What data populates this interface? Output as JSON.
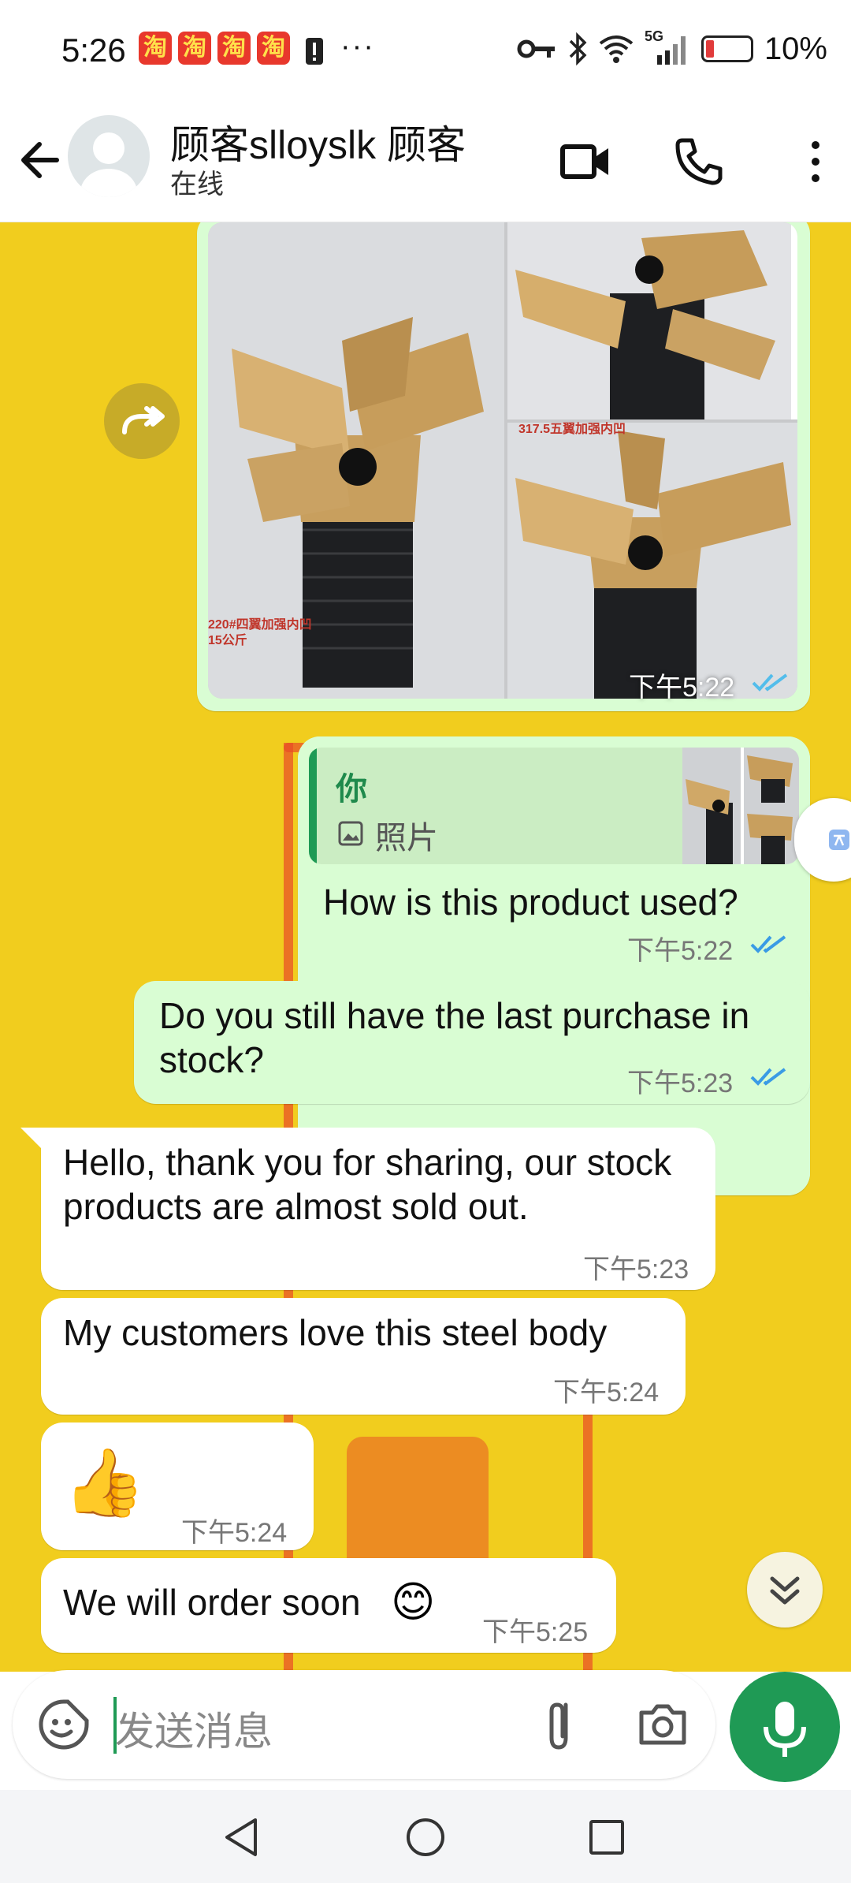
{
  "status_bar": {
    "time": "5:26",
    "app_badge": "淘",
    "more": "···",
    "network": "5G",
    "battery": "10%"
  },
  "header": {
    "contact_name": "顾客slloyslk 顾客",
    "status": "在线"
  },
  "messages": {
    "image_time": "下午5:22",
    "reply_quote_author": "你",
    "reply_quote_type": "照片",
    "m1_text": "How is this product used?",
    "m1_time": "下午5:22",
    "m2_text": "Do you still have the last purchase in stock?",
    "m2_time": "下午5:23",
    "m3_text": "Hello, thank you for sharing, our stock products are almost sold out.",
    "m3_time": "下午5:23",
    "m4_text": "My customers love this steel body",
    "m4_time": "下午5:24",
    "m5_emoji": "👍",
    "m5_time": "下午5:24",
    "m6_text": "We will order soon",
    "m6_emoji": "😊",
    "m6_time": "下午5:25"
  },
  "photo_labels": {
    "label_1": "220#四翼加强内凹",
    "label_2": "15公斤",
    "label_3": "317.5五翼加强内凹"
  },
  "composer": {
    "placeholder": "发送消息"
  },
  "colors": {
    "outgoing_bubble": "#d9fdd3",
    "incoming_bubble": "#ffffff",
    "wallpaper": "#f1cd1e",
    "accent_green": "#1f9a55",
    "read_ticks": "#3a9be5"
  }
}
